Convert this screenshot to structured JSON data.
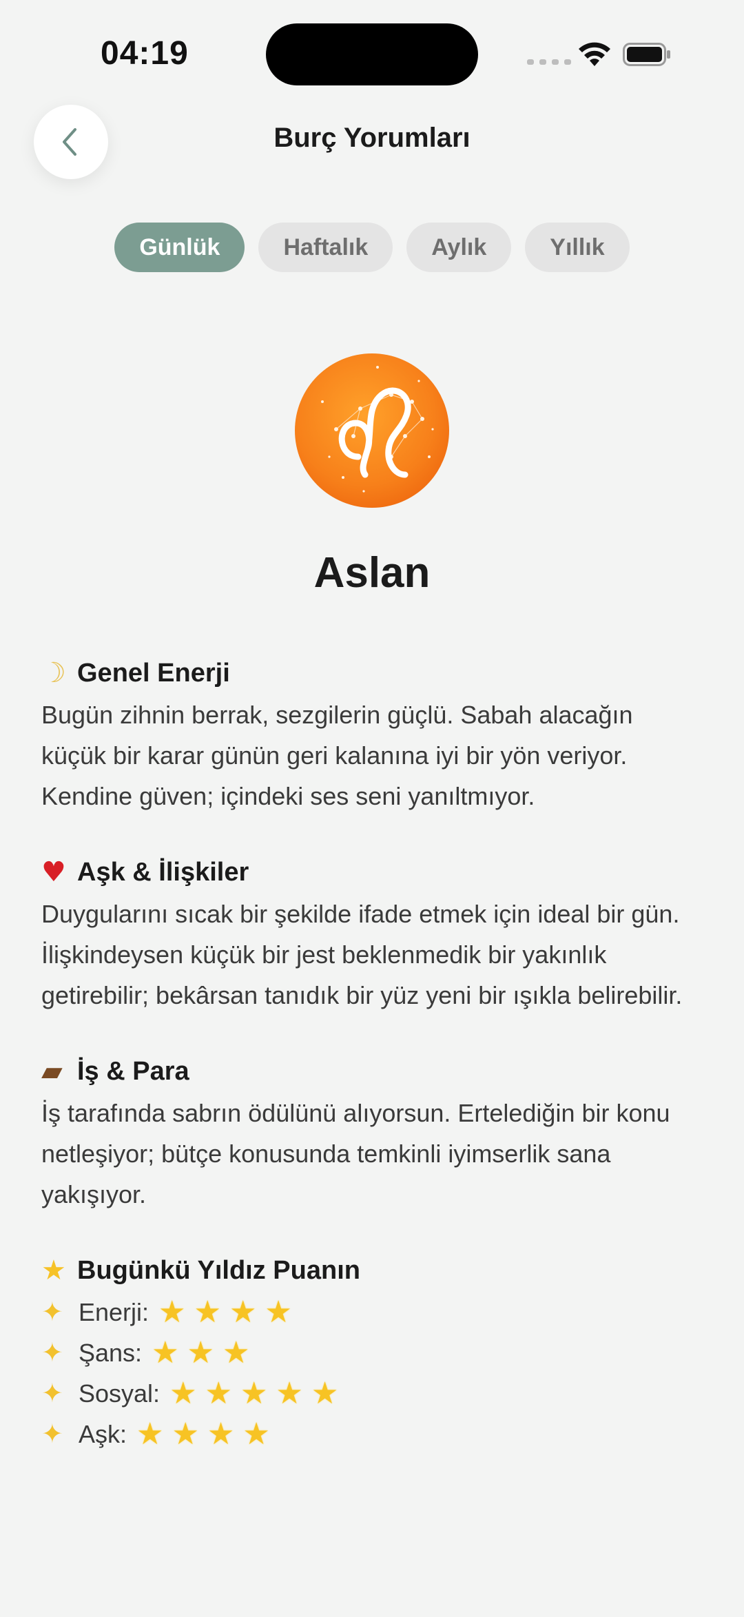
{
  "status_bar": {
    "time": "04:19"
  },
  "header": {
    "title": "Burç Yorumları",
    "back_icon": "chevron-left-icon"
  },
  "tabs": [
    {
      "label": "Günlük",
      "active": true
    },
    {
      "label": "Haftalık",
      "active": false
    },
    {
      "label": "Aylık",
      "active": false
    },
    {
      "label": "Yıllık",
      "active": false
    }
  ],
  "sign": {
    "name": "Aslan",
    "emblem_icon": "leo-zodiac-icon",
    "emblem_color": "#f7851e"
  },
  "sections": {
    "general": {
      "emoji": "☽",
      "title": "Genel Enerji",
      "body": "Bugün zihnin berrak, sezgilerin güçlü. Sabah alacağın küçük bir karar günün geri kalanına iyi bir yön veriyor. Kendine güven; içindeki ses seni yanıltmıyor."
    },
    "love": {
      "emoji": "♥",
      "title": "Aşk & İlişkiler",
      "body": "Duygularını sıcak bir şekilde ifade etmek için ideal bir gün. İlişkindeysen küçük bir jest beklenmedik bir yakınlık getirebilir; bekârsan tanıdık bir yüz yeni bir ışıkla belirebilir."
    },
    "work": {
      "emoji": "▰",
      "title": "İş & Para",
      "body": "İş tarafında sabrın ödülünü alıyorsun. Ertelediğin bir konu netleşiyor; bütçe konusunda temkinli iyimserlik sana yakışıyor."
    },
    "rating": {
      "emoji": "★",
      "title": "Bugünkü Yıldız Puanın",
      "sparkle": "✦",
      "items": [
        {
          "label": "Enerji:",
          "stars": "★★★★"
        },
        {
          "label": "Şans:",
          "stars": "★★★"
        },
        {
          "label": "Sosyal:",
          "stars": "★★★★★"
        },
        {
          "label": "Aşk:",
          "stars": "★★★★"
        }
      ]
    }
  }
}
